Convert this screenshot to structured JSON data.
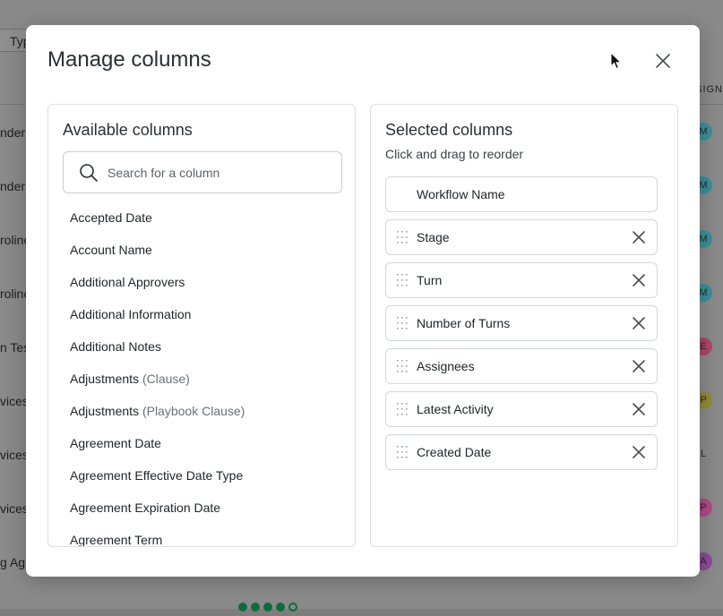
{
  "background": {
    "filter_chip": "Typ",
    "assign_header": "SSIGN",
    "rows": [
      "nder",
      "nder",
      "roline",
      "roline",
      "n Tes",
      "vices",
      "vices",
      "vices",
      "g Ag"
    ],
    "avatars": [
      {
        "letter": "M",
        "color": "#3a8f9a"
      },
      {
        "letter": "M",
        "color": "#3a8f9a"
      },
      {
        "letter": "M",
        "color": "#3a8f9a"
      },
      {
        "letter": "M",
        "color": "#3a8f9a"
      },
      {
        "letter": "E",
        "color": "#b0456d"
      },
      {
        "letter": "P",
        "color": "#8f8a3a"
      },
      {
        "letter": "L",
        "color": "#8a8a8a"
      },
      {
        "letter": "P",
        "color": "#b04a87"
      },
      {
        "letter": "A",
        "color": "#8a4a9a"
      }
    ]
  },
  "modal": {
    "title": "Manage columns",
    "close_icon": "close-icon",
    "available": {
      "title": "Available columns",
      "search_placeholder": "Search for a column",
      "items": [
        {
          "label": "Accepted Date",
          "tag": ""
        },
        {
          "label": "Account Name",
          "tag": ""
        },
        {
          "label": "Additional Approvers",
          "tag": ""
        },
        {
          "label": "Additional Information",
          "tag": ""
        },
        {
          "label": "Additional Notes",
          "tag": ""
        },
        {
          "label": "Adjustments",
          "tag": "(Clause)"
        },
        {
          "label": "Adjustments",
          "tag": "(Playbook Clause)"
        },
        {
          "label": "Agreement Date",
          "tag": ""
        },
        {
          "label": "Agreement Effective Date Type",
          "tag": ""
        },
        {
          "label": "Agreement Expiration Date",
          "tag": ""
        },
        {
          "label": "Agreement Term",
          "tag": ""
        }
      ]
    },
    "selected": {
      "title": "Selected columns",
      "subtitle": "Click and drag to reorder",
      "items": [
        {
          "label": "Workflow Name",
          "fixed": true
        },
        {
          "label": "Stage",
          "fixed": false
        },
        {
          "label": "Turn",
          "fixed": false
        },
        {
          "label": "Number of Turns",
          "fixed": false
        },
        {
          "label": "Assignees",
          "fixed": false
        },
        {
          "label": "Latest Activity",
          "fixed": false
        },
        {
          "label": "Created Date",
          "fixed": false
        }
      ]
    }
  }
}
